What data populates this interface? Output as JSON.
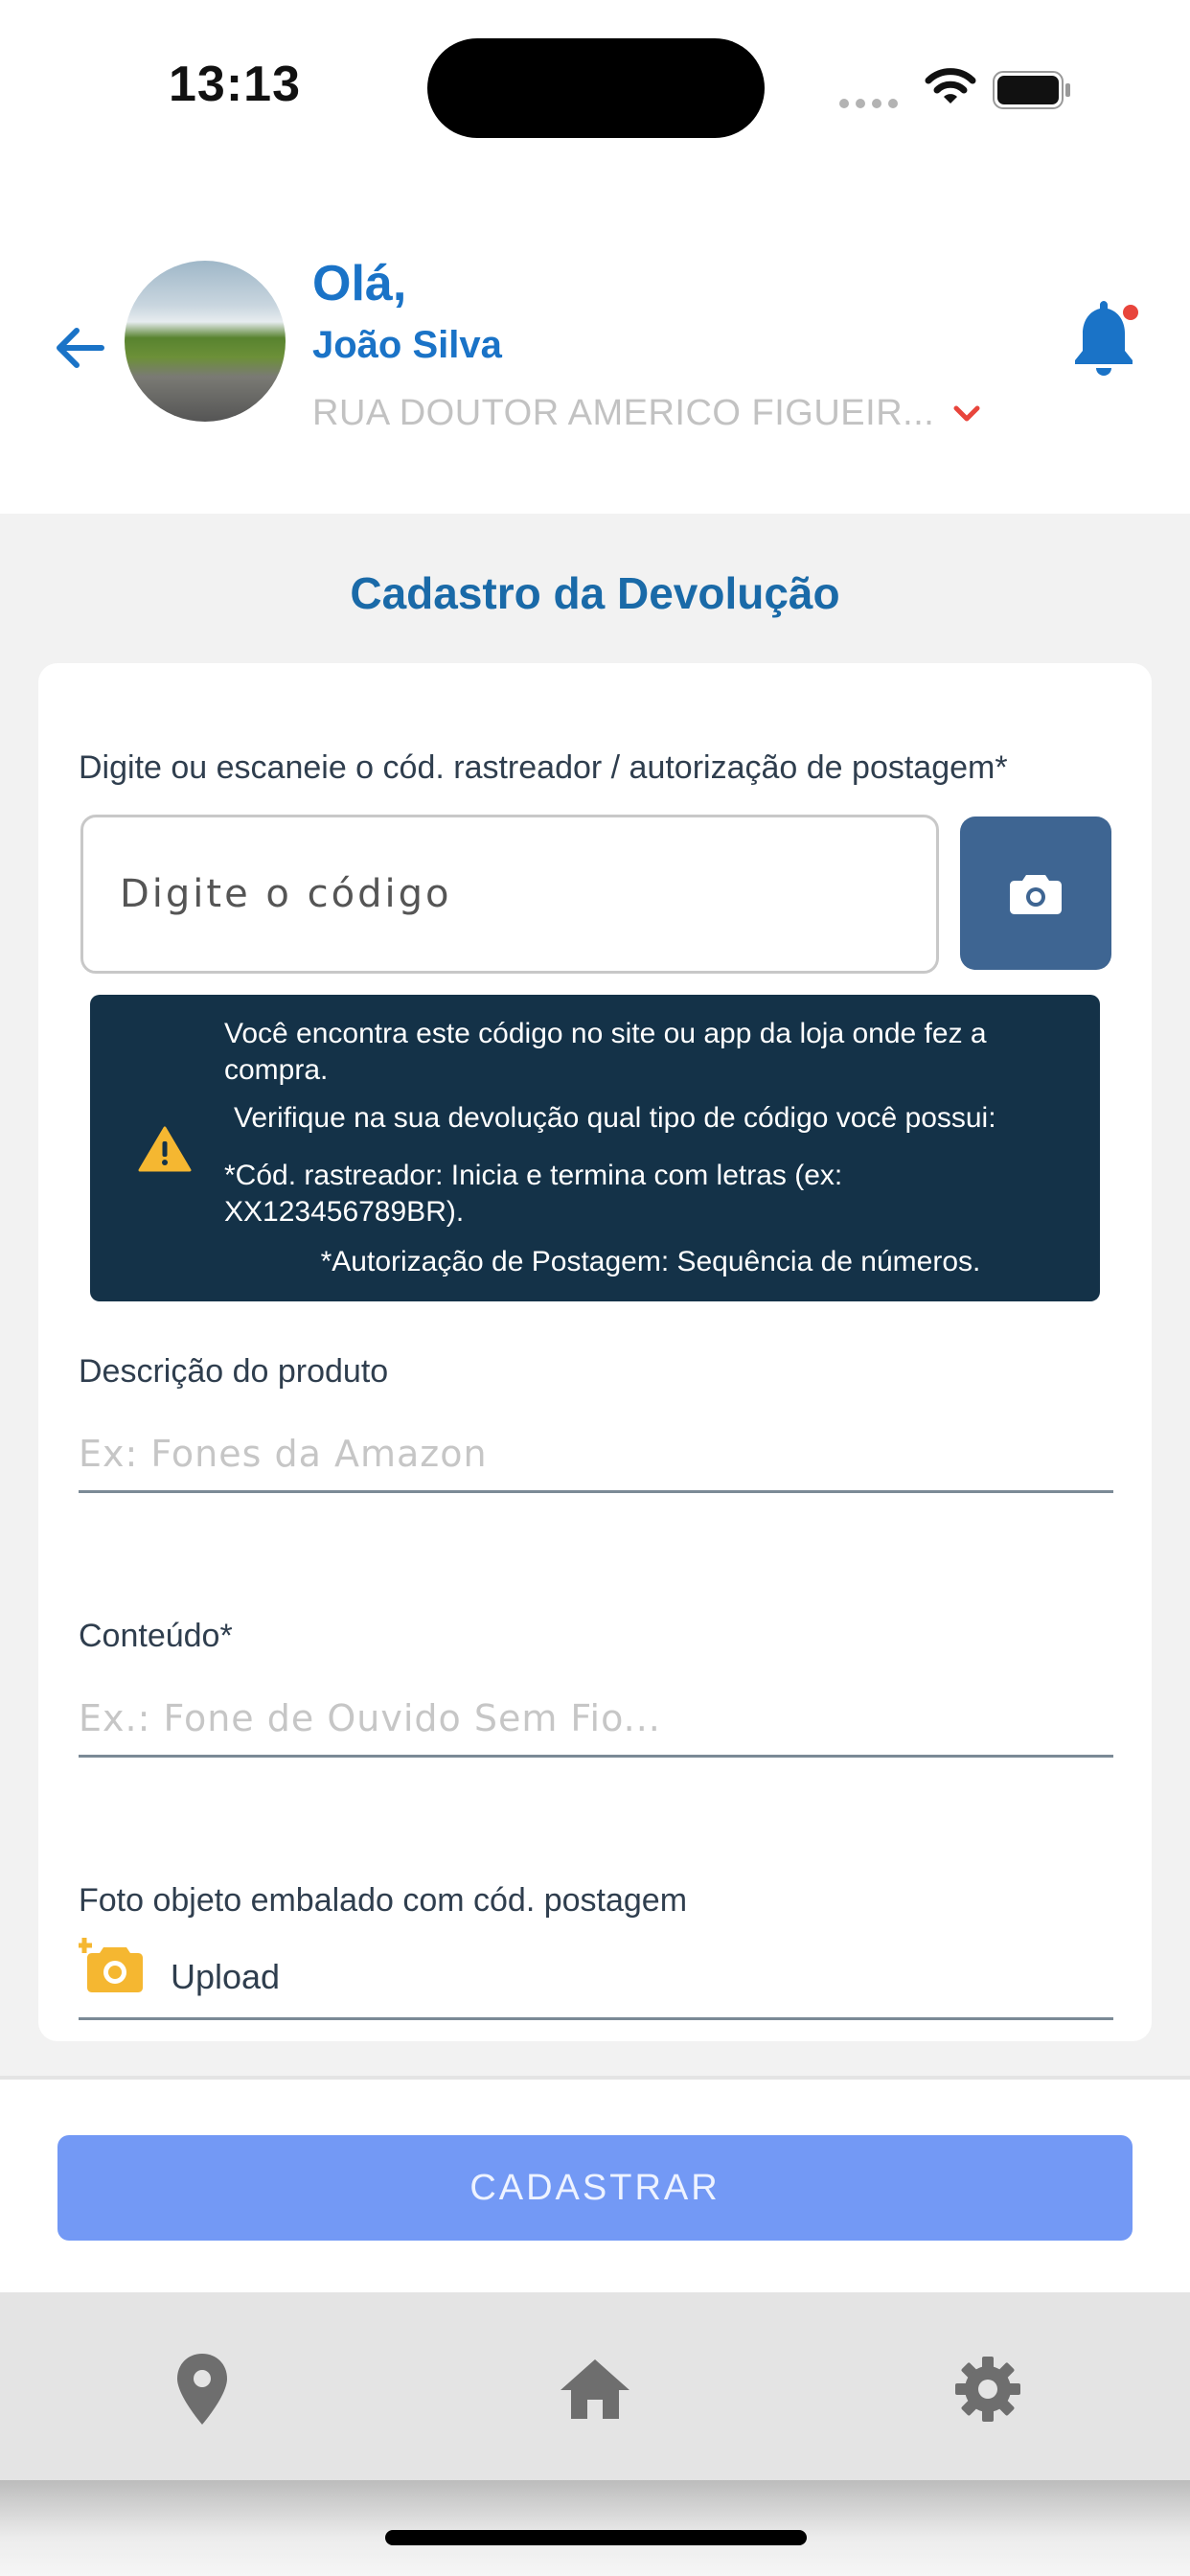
{
  "status_bar": {
    "time": "13:13"
  },
  "header": {
    "greeting": "Olá,",
    "user_name": "João Silva",
    "address": "RUA DOUTOR AMERICO FIGUEIR...",
    "accent_color": "#1a73c7",
    "notification_dot_color": "#e8453c"
  },
  "main": {
    "title": "Cadastro da Devolução",
    "code_field": {
      "label": "Digite ou escaneie o cód. rastreador / autorização de postagem*",
      "placeholder": "Digite o código",
      "value": ""
    },
    "info_box": {
      "line1": "Você encontra este código no site ou app da loja onde fez a",
      "line2": "compra.",
      "line3": "Verifique na sua devolução qual tipo de código você possui:",
      "line4": "*Cód. rastreador: Inicia e termina com letras (ex:",
      "line5": "XX123456789BR).",
      "line6": "*Autorização de Postagem: Sequência de números."
    },
    "description_field": {
      "label": "Descrição do produto",
      "placeholder": "Ex: Fones da Amazon",
      "value": ""
    },
    "content_field": {
      "label": "Conteúdo*",
      "placeholder": "Ex.: Fone de Ouvido Sem Fio...",
      "value": ""
    },
    "photo_field": {
      "label": "Foto objeto embalado com cód. postagem",
      "upload_label": "Upload"
    }
  },
  "actions": {
    "submit_label": "CADASTRAR",
    "submit_color": "#7399f5"
  },
  "tab_bar": {
    "items": [
      {
        "icon": "map-pin-icon"
      },
      {
        "icon": "home-icon"
      },
      {
        "icon": "gear-icon"
      }
    ]
  }
}
